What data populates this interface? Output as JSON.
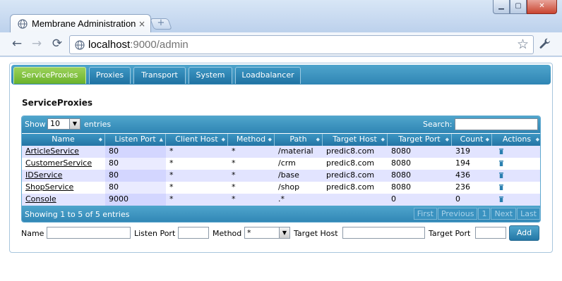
{
  "browser": {
    "tab_title": "Membrane Administration",
    "tab_close": "×",
    "new_tab": "+",
    "window_buttons": {
      "minimize": "▁",
      "maximize": "▢",
      "close": "✕"
    },
    "nav": {
      "back": "←",
      "forward": "→",
      "reload": "⟳"
    },
    "url_host": "localhost",
    "url_rest": ":9000/admin",
    "star": "☆",
    "wrench": "🔧"
  },
  "nav_tabs": [
    {
      "label": "ServiceProxies",
      "active": true
    },
    {
      "label": "Proxies",
      "active": false
    },
    {
      "label": "Transport",
      "active": false
    },
    {
      "label": "System",
      "active": false
    },
    {
      "label": "Loadbalancer",
      "active": false
    }
  ],
  "page": {
    "heading": "ServiceProxies"
  },
  "table": {
    "show_label": "Show",
    "length_value": "10",
    "entries_label": "entries",
    "search_label": "Search:",
    "search_value": "",
    "columns": [
      "Name",
      "Listen Port",
      "Client Host",
      "Method",
      "Path",
      "Target Host",
      "Target Port",
      "Count",
      "Actions"
    ],
    "sorted_column": "Listen Port",
    "rows": [
      {
        "name": "ArticleService",
        "listen_port": "80",
        "client_host": "*",
        "method": "*",
        "path": "/material",
        "target_host": "predic8.com",
        "target_port": "8080",
        "count": "319"
      },
      {
        "name": "CustomerService",
        "listen_port": "80",
        "client_host": "*",
        "method": "*",
        "path": "/crm",
        "target_host": "predic8.com",
        "target_port": "8080",
        "count": "194"
      },
      {
        "name": "IDService",
        "listen_port": "80",
        "client_host": "*",
        "method": "*",
        "path": "/base",
        "target_host": "predic8.com",
        "target_port": "8080",
        "count": "436"
      },
      {
        "name": "ShopService",
        "listen_port": "80",
        "client_host": "*",
        "method": "*",
        "path": "/shop",
        "target_host": "predic8.com",
        "target_port": "8080",
        "count": "236"
      },
      {
        "name": "Console",
        "listen_port": "9000",
        "client_host": "*",
        "method": "*",
        "path": ".*",
        "target_host": "",
        "target_port": "0",
        "count": "0"
      }
    ],
    "info": "Showing 1 to 5 of 5 entries",
    "pager": {
      "first": "First",
      "previous": "Previous",
      "page": "1",
      "next": "Next",
      "last": "Last"
    }
  },
  "add_form": {
    "name_label": "Name",
    "listen_port_label": "Listen Port",
    "method_label": "Method",
    "method_value": "*",
    "target_host_label": "Target Host",
    "target_port_label": "Target Port",
    "add_button": "Add"
  },
  "colors": {
    "nav_blue": "#2f85b4",
    "active_green": "#6bb22c",
    "odd_row": "#e2e4ff",
    "sorted_col": "#d3d6ff"
  },
  "icons": [
    "globe-icon",
    "back-icon",
    "forward-icon",
    "reload-icon",
    "page-icon",
    "star-icon",
    "wrench-icon",
    "trash-icon",
    "chevron-down-icon"
  ]
}
